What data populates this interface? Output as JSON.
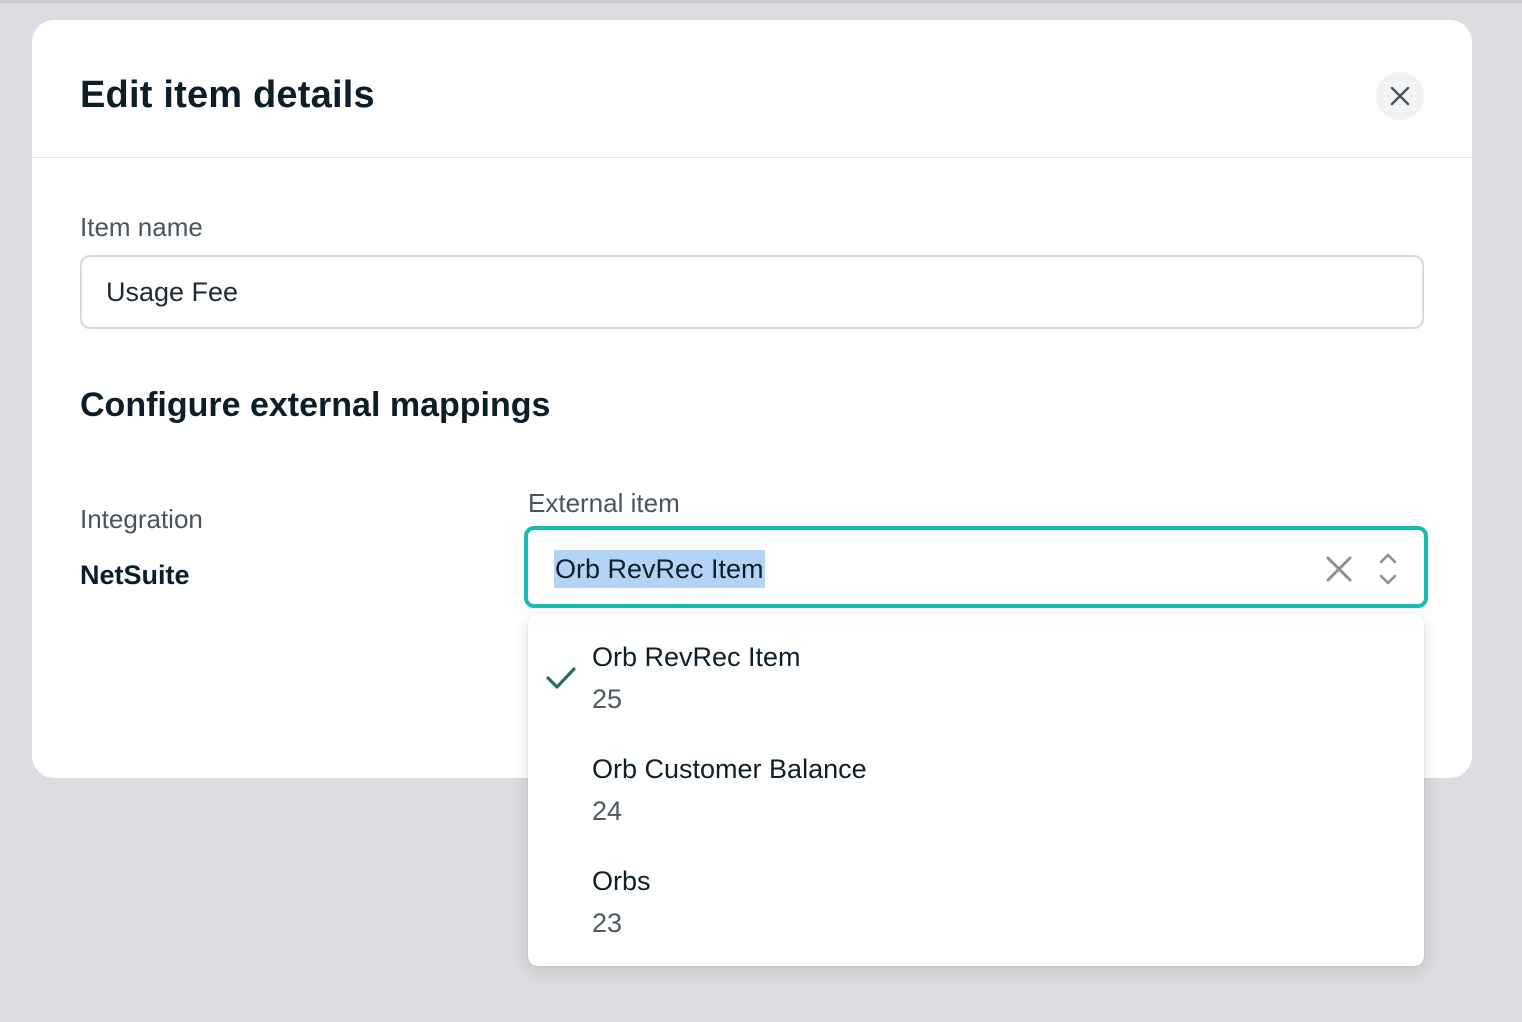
{
  "modal": {
    "title": "Edit item details",
    "close_icon": "close-icon"
  },
  "item_name": {
    "label": "Item name",
    "value": "Usage Fee"
  },
  "mappings": {
    "section_title": "Configure external mappings",
    "integration_label": "Integration",
    "integration_value": "NetSuite",
    "external_item_label": "External item",
    "selected_value": "Orb RevRec Item",
    "clear_icon": "clear-icon",
    "toggle_icon": "chevron-updown-icon"
  },
  "dropdown": {
    "options": [
      {
        "title": "Orb RevRec Item",
        "id": "25",
        "selected": true
      },
      {
        "title": "Orb Customer Balance",
        "id": "24",
        "selected": false
      },
      {
        "title": "Orbs",
        "id": "23",
        "selected": false
      }
    ]
  },
  "colors": {
    "accent": "#17bdb4",
    "check": "#2d6b62",
    "selection_highlight": "#b3d3f7"
  }
}
